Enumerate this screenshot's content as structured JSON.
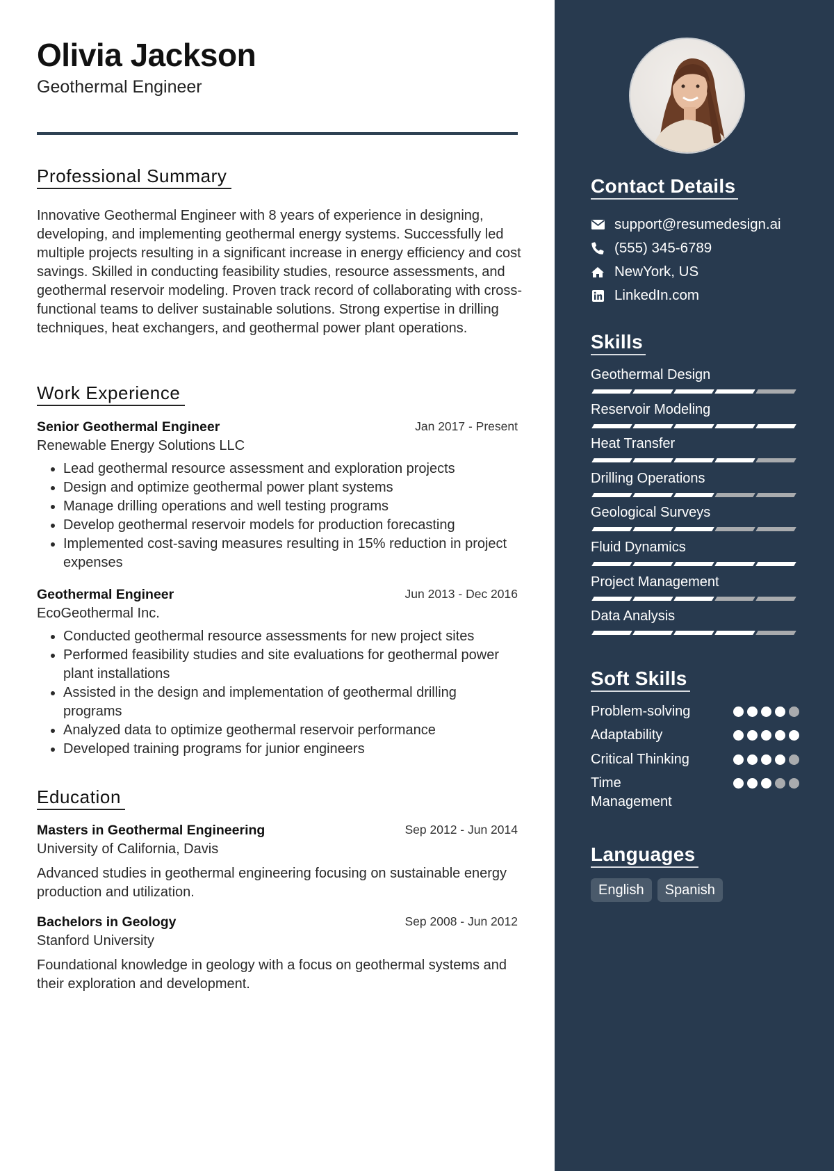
{
  "header": {
    "name": "Olivia Jackson",
    "title": "Geothermal Engineer"
  },
  "summary": {
    "heading": "Professional Summary",
    "text": "Innovative Geothermal Engineer with 8 years of experience in designing, developing, and implementing geothermal energy systems. Successfully led multiple projects resulting in a significant increase in energy efficiency and cost savings. Skilled in conducting feasibility studies, resource assessments, and geothermal reservoir modeling. Proven track record of collaborating with cross-functional teams to deliver sustainable solutions. Strong expertise in drilling techniques, heat exchangers, and geothermal power plant operations."
  },
  "experience": {
    "heading": "Work Experience",
    "jobs": [
      {
        "title": "Senior Geothermal Engineer",
        "dates": "Jan 2017 - Present",
        "company": "Renewable Energy Solutions LLC",
        "bullets": [
          "Lead geothermal resource assessment and exploration projects",
          "Design and optimize geothermal power plant systems",
          "Manage drilling operations and well testing programs",
          "Develop geothermal reservoir models for production forecasting",
          "Implemented cost-saving measures resulting in 15% reduction in project expenses"
        ]
      },
      {
        "title": "Geothermal Engineer",
        "dates": "Jun 2013 - Dec 2016",
        "company": "EcoGeothermal Inc.",
        "bullets": [
          "Conducted geothermal resource assessments for new project sites",
          "Performed feasibility studies and site evaluations for geothermal power plant installations",
          "Assisted in the design and implementation of geothermal drilling programs",
          "Analyzed data to optimize geothermal reservoir performance",
          "Developed training programs for junior engineers"
        ]
      }
    ]
  },
  "education": {
    "heading": "Education",
    "items": [
      {
        "degree": "Masters in Geothermal Engineering",
        "dates": "Sep 2012 - Jun 2014",
        "school": "University of California, Davis",
        "description": "Advanced studies in geothermal engineering focusing on sustainable energy production and utilization."
      },
      {
        "degree": "Bachelors in Geology",
        "dates": "Sep 2008 - Jun 2012",
        "school": "Stanford University",
        "description": "Foundational knowledge in geology with a focus on geothermal systems and their exploration and development."
      }
    ]
  },
  "sidebar": {
    "photo_alt": "profile-photo",
    "contact": {
      "heading": "Contact Details",
      "items": [
        {
          "icon": "envelope-icon",
          "text": "support@resumedesign.ai"
        },
        {
          "icon": "phone-icon",
          "text": "(555) 345-6789"
        },
        {
          "icon": "home-icon",
          "text": "NewYork, US"
        },
        {
          "icon": "linkedin-icon",
          "text": "LinkedIn.com"
        }
      ]
    },
    "skills": {
      "heading": "Skills",
      "max": 5,
      "items": [
        {
          "name": "Geothermal Design",
          "level": 4
        },
        {
          "name": "Reservoir Modeling",
          "level": 5
        },
        {
          "name": "Heat Transfer",
          "level": 4
        },
        {
          "name": "Drilling Operations",
          "level": 3
        },
        {
          "name": "Geological Surveys",
          "level": 3
        },
        {
          "name": "Fluid Dynamics",
          "level": 5
        },
        {
          "name": "Project Management",
          "level": 3
        },
        {
          "name": "Data Analysis",
          "level": 4
        }
      ]
    },
    "soft_skills": {
      "heading": "Soft Skills",
      "max": 5,
      "items": [
        {
          "name": "Problem-solving",
          "level": 4
        },
        {
          "name": "Adaptability",
          "level": 5
        },
        {
          "name": "Critical Thinking",
          "level": 4
        },
        {
          "name": "Time Management",
          "level": 3
        }
      ]
    },
    "languages": {
      "heading": "Languages",
      "items": [
        "English",
        "Spanish"
      ]
    }
  },
  "colors": {
    "sidebar_bg": "#283a4f",
    "rating_on": "#ffffff",
    "rating_off": "#a9abae",
    "language_chip": "#4a5a6b"
  }
}
